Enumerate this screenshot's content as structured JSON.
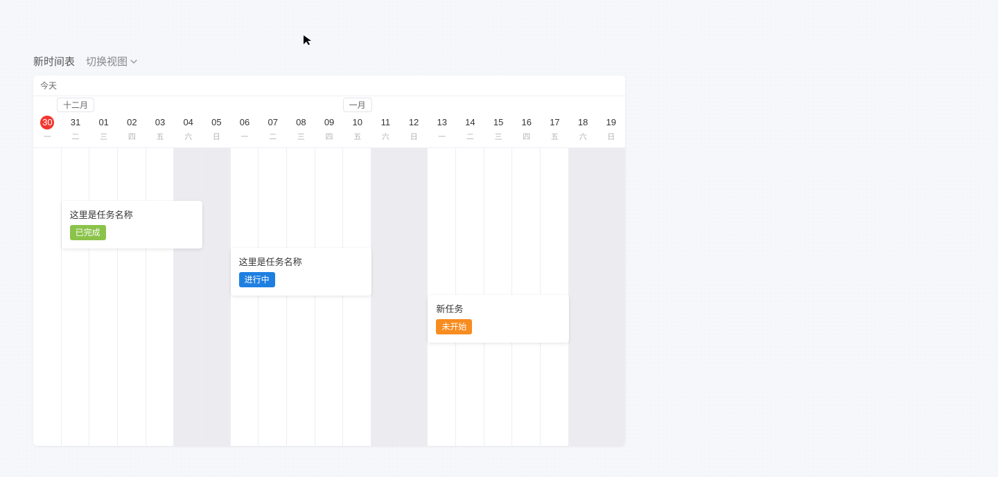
{
  "header": {
    "title": "新时间表",
    "view_switch_label": "切换视图"
  },
  "today_label": "今天",
  "months": [
    {
      "label": "十二月",
      "center_day_index": 1
    },
    {
      "label": "一月",
      "center_day_index": 11
    }
  ],
  "days": [
    {
      "num": "30",
      "dow": "一",
      "weekend": false,
      "today": true
    },
    {
      "num": "31",
      "dow": "二",
      "weekend": false,
      "today": false
    },
    {
      "num": "01",
      "dow": "三",
      "weekend": false,
      "today": false
    },
    {
      "num": "02",
      "dow": "四",
      "weekend": false,
      "today": false
    },
    {
      "num": "03",
      "dow": "五",
      "weekend": false,
      "today": false
    },
    {
      "num": "04",
      "dow": "六",
      "weekend": true,
      "today": false
    },
    {
      "num": "05",
      "dow": "日",
      "weekend": true,
      "today": false
    },
    {
      "num": "06",
      "dow": "一",
      "weekend": false,
      "today": false
    },
    {
      "num": "07",
      "dow": "二",
      "weekend": false,
      "today": false
    },
    {
      "num": "08",
      "dow": "三",
      "weekend": false,
      "today": false
    },
    {
      "num": "09",
      "dow": "四",
      "weekend": false,
      "today": false
    },
    {
      "num": "10",
      "dow": "五",
      "weekend": false,
      "today": false
    },
    {
      "num": "11",
      "dow": "六",
      "weekend": true,
      "today": false
    },
    {
      "num": "12",
      "dow": "日",
      "weekend": true,
      "today": false
    },
    {
      "num": "13",
      "dow": "一",
      "weekend": false,
      "today": false
    },
    {
      "num": "14",
      "dow": "二",
      "weekend": false,
      "today": false
    },
    {
      "num": "15",
      "dow": "三",
      "weekend": false,
      "today": false
    },
    {
      "num": "16",
      "dow": "四",
      "weekend": false,
      "today": false
    },
    {
      "num": "17",
      "dow": "五",
      "weekend": false,
      "today": false
    },
    {
      "num": "18",
      "dow": "六",
      "weekend": true,
      "today": false
    },
    {
      "num": "19",
      "dow": "日",
      "weekend": true,
      "today": false
    }
  ],
  "tasks": [
    {
      "title": "这里是任务名称",
      "status_label": "已完成",
      "status_kind": "done",
      "start_index": 1,
      "end_index": 6,
      "row": 0
    },
    {
      "title": "这里是任务名称",
      "status_label": "进行中",
      "status_kind": "progress",
      "start_index": 7,
      "end_index": 12,
      "row": 1
    },
    {
      "title": "新任务",
      "status_label": "未开始",
      "status_kind": "notstart",
      "start_index": 14,
      "end_index": 19,
      "row": 2
    }
  ]
}
